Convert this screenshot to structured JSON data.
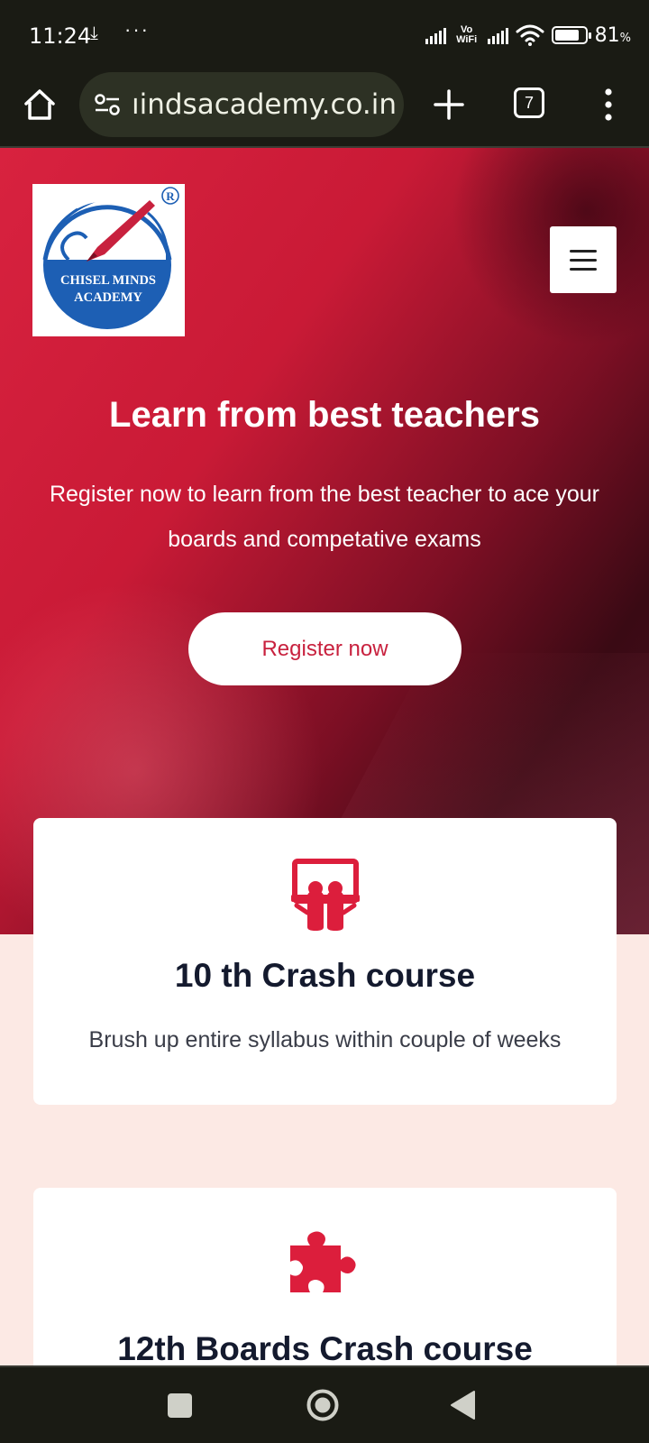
{
  "status_bar": {
    "time": "11:24",
    "download_glyph": "⤓",
    "more_dots": "···",
    "network_label": "Vo WiFi",
    "battery_percent": "81",
    "battery_unit": "%",
    "battery_level": 0.81
  },
  "browser": {
    "url": "ıindsacademy.co.in",
    "tab_count": "7"
  },
  "site": {
    "logo": {
      "line1": "CHISEL MINDS",
      "line2": "ACADEMY",
      "registered_mark": "R"
    },
    "hero": {
      "title": "Learn from best teachers",
      "subtitle": "Register now to learn from the best teacher to ace your boards and competative exams",
      "cta_label": "Register now"
    },
    "courses": [
      {
        "icon": "presentation-icon",
        "title": "10 th Crash course",
        "description": "Brush up entire syllabus within couple of weeks"
      },
      {
        "icon": "puzzle-icon",
        "title": "12th Boards Crash course"
      }
    ]
  },
  "colors": {
    "accent": "#dc1e3c",
    "status_bg": "#1a1b14",
    "page_bg": "#fce9e4",
    "logo_blue": "#1d5fb4"
  }
}
